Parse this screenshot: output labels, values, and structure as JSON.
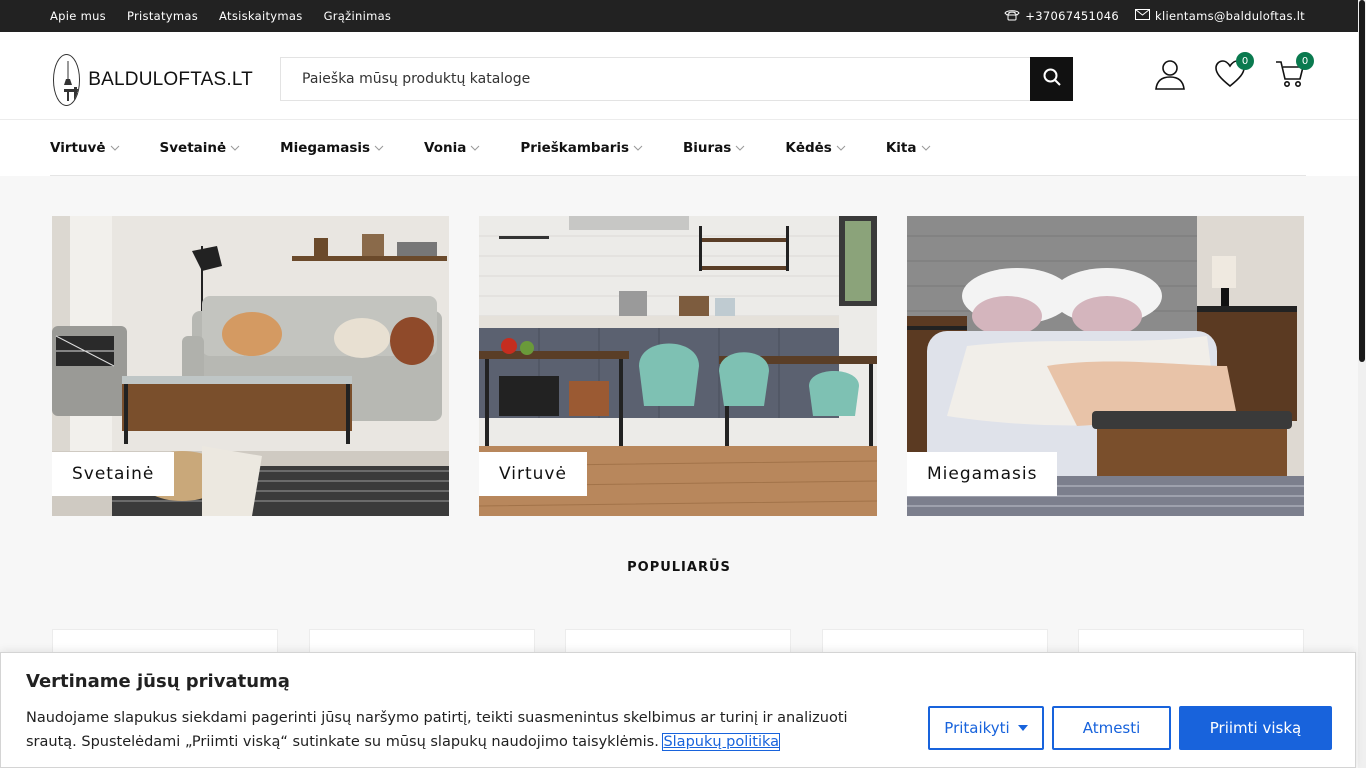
{
  "topbar": {
    "links": [
      "Apie mus",
      "Pristatymas",
      "Atsiskaitymas",
      "Grąžinimas"
    ],
    "phone": "+37067451046",
    "email": "klientams@balduloftas.lt"
  },
  "header": {
    "logo_text": "BALDULOFTAS.LT",
    "search_placeholder": "Paieška mūsų produktų kataloge",
    "wishlist_count": "0",
    "cart_count": "0"
  },
  "nav": {
    "items": [
      "Virtuvė",
      "Svetainė",
      "Miegamasis",
      "Vonia",
      "Prieškambaris",
      "Biuras",
      "Kėdės",
      "Kita"
    ]
  },
  "categories": [
    {
      "label": "Svetainė"
    },
    {
      "label": "Virtuvė"
    },
    {
      "label": "Miegamasis"
    }
  ],
  "popular_heading": "POPULIARŪS",
  "cookie": {
    "title": "Vertiname jūsų privatumą",
    "text": "Naudojame slapukus siekdami pagerinti jūsų naršymo patirtį, teikti suasmenintus skelbimus ar turinį ir analizuoti srautą. Spustelėdami „Priimti viską“ sutinkate su mūsų slapukų naudojimo taisyklėmis.",
    "policy_link": "Slapukų politika",
    "customize_label": "Pritaikyti",
    "reject_label": "Atmesti",
    "accept_label": "Priimti viską"
  },
  "colors": {
    "topbar": "#222222",
    "accent_blue": "#1863dc",
    "badge_green": "#0a7a4f"
  }
}
